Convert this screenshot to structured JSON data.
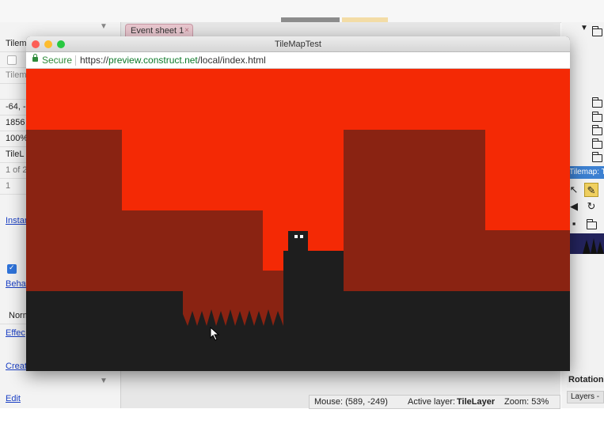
{
  "editor": {
    "tab_label": "Event sheet 1",
    "tab_close": "×",
    "left_panel": {
      "rows": [
        "Tilem",
        "",
        "Tilem",
        "",
        "-64, -",
        "1856",
        "100%",
        "TileL",
        "1 of 2",
        "1",
        "Instar",
        "",
        "Behav",
        "Norm",
        "Effec",
        "Creat",
        "Edit"
      ]
    },
    "right_panel": {
      "tilemap_bar": "Tilemap: T",
      "rotation_label": "Rotation",
      "layers_tab": "Layers -"
    },
    "status": {
      "mouse": "Mouse: (589, -249)",
      "active_layer_label": "Active layer:",
      "active_layer_value": "TileLayer",
      "zoom": "Zoom: 53%"
    }
  },
  "browser": {
    "title": "TileMapTest",
    "secure_label": "Secure",
    "url_scheme": "https://",
    "url_host": "preview.construct.net",
    "url_path": "/local/index.html"
  },
  "colors": {
    "sky": "#f42905",
    "wall": "#8a2312",
    "ground": "#1e1e1e",
    "player_eye": "#ffffff"
  },
  "icons": [
    "lock-icon",
    "folder-icon",
    "pencil-icon",
    "cursor-icon",
    "rotate-icon",
    "flip-icon",
    "save-icon"
  ]
}
